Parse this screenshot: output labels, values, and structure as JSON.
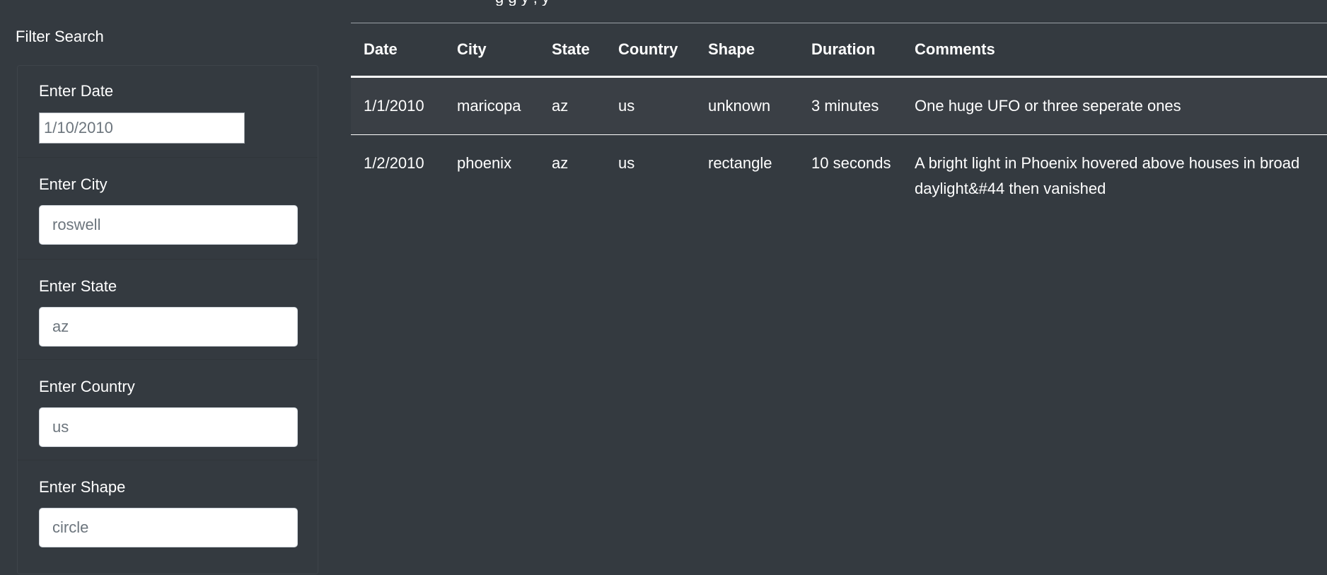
{
  "page": {
    "top_text": "g g     y    ,              y"
  },
  "sidebar": {
    "title": "Filter Search",
    "filters": [
      {
        "label": "Enter Date",
        "placeholder": "1/10/2010"
      },
      {
        "label": "Enter City",
        "placeholder": "roswell"
      },
      {
        "label": "Enter State",
        "placeholder": "az"
      },
      {
        "label": "Enter Country",
        "placeholder": "us"
      },
      {
        "label": "Enter Shape",
        "placeholder": "circle"
      }
    ]
  },
  "table": {
    "headers": [
      "Date",
      "City",
      "State",
      "Country",
      "Shape",
      "Duration",
      "Comments"
    ],
    "rows": [
      {
        "date": "1/1/2010",
        "city": "maricopa",
        "state": "az",
        "country": "us",
        "shape": "unknown",
        "duration": "3 minutes",
        "comments": "One huge UFO or three seperate ones"
      },
      {
        "date": "1/2/2010",
        "city": "phoenix",
        "state": "az",
        "country": "us",
        "shape": "rectangle",
        "duration": "10 seconds",
        "comments": "A bright light in Phoenix hovered above houses in broad daylight&#44 then vanished"
      }
    ]
  }
}
